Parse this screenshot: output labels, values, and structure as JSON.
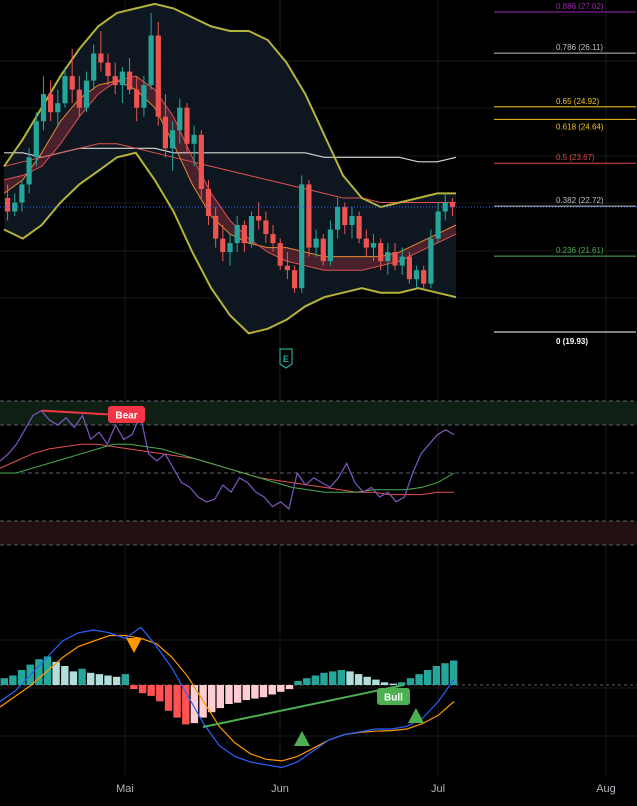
{
  "colors": {
    "background": "#000000",
    "grid": "#1a1a1a",
    "up_candle": "#26a69a",
    "down_candle": "#ef5350",
    "bollinger": "#b5b33a",
    "bollinger_fill": "#0f1a22",
    "ema_fast": "#e68a2e",
    "ema_slow": "#e05252",
    "sma_long": "#d8d8d8",
    "rsi_line": "#7e57c2",
    "rsi_ma_a": "#e05252",
    "rsi_ma_b": "#4caf50",
    "rsi_overbought_zone": "#0f1f14",
    "rsi_oversold_zone": "#220f12",
    "macd_line": "#2962ff",
    "signal_line": "#ff9800",
    "hist_up_strong": "#26a69a",
    "hist_up_weak": "#b2dfdb",
    "hist_down_strong": "#ff5252",
    "hist_down_weak": "#ffcdd2",
    "bear_badge": "#f23645",
    "bull_badge": "#4caf50",
    "current_price_line": "#2962ff"
  },
  "chart_data": [
    {
      "type": "candlestick",
      "panel": "price",
      "x_axis_labels": [
        "Mai",
        "Jun",
        "Jul",
        "Aug"
      ],
      "earnings_marker": "E",
      "fibonacci_levels": [
        {
          "ratio": "0.886",
          "price": "27.02",
          "label": "0.886 (27.02)",
          "color": "#9c27b0"
        },
        {
          "ratio": "0.786",
          "price": "26.11",
          "label": "0.786 (26.11)",
          "color": "#c0c0c0"
        },
        {
          "ratio": "0.65",
          "price": "24.92",
          "label": "0.65 (24.92)",
          "color": "#f0c419"
        },
        {
          "ratio": "0.618",
          "price": "24.64",
          "label": "0.618 (24.64)",
          "color": "#f0c419"
        },
        {
          "ratio": "0.5",
          "price": "23.67",
          "label": "0.5 (23.67)",
          "color": "#e04848"
        },
        {
          "ratio": "0.382",
          "price": "22.72",
          "label": "0.382 (22.72)",
          "color": "#c0c0c0"
        },
        {
          "ratio": "0.236",
          "price": "21.61",
          "label": "0.236 (21.61)",
          "color": "#4caf50"
        },
        {
          "ratio": "0",
          "price": "19.93",
          "label": "0 (19.93)",
          "color": "#ffffff"
        }
      ],
      "price_range": [
        19.93,
        27.02
      ],
      "candles": [
        [
          22.9,
          23.2,
          22.4,
          22.6
        ],
        [
          22.6,
          23.0,
          22.5,
          22.8
        ],
        [
          22.8,
          23.3,
          22.6,
          23.2
        ],
        [
          23.2,
          24.0,
          23.0,
          23.8
        ],
        [
          23.8,
          24.8,
          23.6,
          24.6
        ],
        [
          24.6,
          25.6,
          24.4,
          25.2
        ],
        [
          25.2,
          25.5,
          24.6,
          24.8
        ],
        [
          24.8,
          25.3,
          24.5,
          25.0
        ],
        [
          25.0,
          25.8,
          24.9,
          25.6
        ],
        [
          25.6,
          26.2,
          25.0,
          25.3
        ],
        [
          25.3,
          25.6,
          24.7,
          24.9
        ],
        [
          24.9,
          25.7,
          24.8,
          25.5
        ],
        [
          25.5,
          26.3,
          25.3,
          26.1
        ],
        [
          26.1,
          26.6,
          25.7,
          25.9
        ],
        [
          25.9,
          26.1,
          25.4,
          25.6
        ],
        [
          25.6,
          25.9,
          25.2,
          25.4
        ],
        [
          25.4,
          25.8,
          25.0,
          25.7
        ],
        [
          25.7,
          26.0,
          25.2,
          25.3
        ],
        [
          25.3,
          25.6,
          24.6,
          24.9
        ],
        [
          24.9,
          25.6,
          24.7,
          25.4
        ],
        [
          25.4,
          27.0,
          25.3,
          26.5
        ],
        [
          26.5,
          26.8,
          24.5,
          24.7
        ],
        [
          24.7,
          25.2,
          23.8,
          24.0
        ],
        [
          24.0,
          24.6,
          23.5,
          24.4
        ],
        [
          24.4,
          25.1,
          24.1,
          24.9
        ],
        [
          24.9,
          25.0,
          23.9,
          24.1
        ],
        [
          24.1,
          24.5,
          23.6,
          24.3
        ],
        [
          24.3,
          24.4,
          22.9,
          23.1
        ],
        [
          23.1,
          23.3,
          22.3,
          22.5
        ],
        [
          22.5,
          22.7,
          21.8,
          22.0
        ],
        [
          22.0,
          22.3,
          21.5,
          21.7
        ],
        [
          21.7,
          22.1,
          21.4,
          21.9
        ],
        [
          21.9,
          22.5,
          21.7,
          22.3
        ],
        [
          22.3,
          22.4,
          21.7,
          21.9
        ],
        [
          21.9,
          22.6,
          21.8,
          22.5
        ],
        [
          22.5,
          22.8,
          22.2,
          22.4
        ],
        [
          22.4,
          22.6,
          21.9,
          22.1
        ],
        [
          22.1,
          22.3,
          21.7,
          21.9
        ],
        [
          21.9,
          22.0,
          21.3,
          21.4
        ],
        [
          21.4,
          21.7,
          21.1,
          21.3
        ],
        [
          21.3,
          21.4,
          20.8,
          20.9
        ],
        [
          20.9,
          23.4,
          20.8,
          23.2
        ],
        [
          23.2,
          23.3,
          21.6,
          21.8
        ],
        [
          21.8,
          22.2,
          21.6,
          22.0
        ],
        [
          22.0,
          22.1,
          21.4,
          21.5
        ],
        [
          21.5,
          22.4,
          21.4,
          22.2
        ],
        [
          22.2,
          22.9,
          22.0,
          22.7
        ],
        [
          22.7,
          22.8,
          22.1,
          22.3
        ],
        [
          22.3,
          22.7,
          22.0,
          22.5
        ],
        [
          22.5,
          22.6,
          21.9,
          22.0
        ],
        [
          22.0,
          22.2,
          21.6,
          21.8
        ],
        [
          21.8,
          22.1,
          21.5,
          21.9
        ],
        [
          21.9,
          22.0,
          21.3,
          21.5
        ],
        [
          21.5,
          21.9,
          21.2,
          21.7
        ],
        [
          21.7,
          21.9,
          21.3,
          21.4
        ],
        [
          21.4,
          21.8,
          21.2,
          21.6
        ],
        [
          21.6,
          21.7,
          21.0,
          21.1
        ],
        [
          21.1,
          21.4,
          20.9,
          21.3
        ],
        [
          21.3,
          21.4,
          20.9,
          21.0
        ],
        [
          21.0,
          22.2,
          20.9,
          22.0
        ],
        [
          22.0,
          22.8,
          21.9,
          22.6
        ],
        [
          22.6,
          23.0,
          22.4,
          22.8
        ],
        [
          22.8,
          22.9,
          22.5,
          22.7
        ]
      ],
      "bollinger_upper": [
        23.6,
        24.2,
        24.9,
        25.6,
        26.2,
        26.7,
        27.0,
        27.1,
        27.2,
        27.1,
        26.9,
        26.7,
        26.6,
        26.6,
        26.4,
        25.9,
        25.2,
        24.3,
        23.4,
        22.9,
        22.7,
        22.8,
        22.9,
        23.0,
        23.0
      ],
      "bollinger_lower": [
        22.2,
        22.0,
        22.3,
        22.8,
        23.2,
        23.5,
        23.8,
        23.9,
        23.3,
        22.6,
        21.7,
        20.9,
        20.3,
        19.9,
        20.0,
        20.2,
        20.5,
        20.7,
        20.8,
        20.9,
        20.8,
        20.8,
        20.9,
        20.8,
        20.7
      ],
      "ema_fast": [
        23.0,
        23.3,
        23.9,
        24.6,
        25.1,
        25.4,
        25.5,
        25.3,
        24.9,
        24.1,
        23.2,
        22.5,
        22.1,
        21.9,
        21.8,
        21.8,
        21.7,
        21.6,
        21.6,
        21.6,
        21.6,
        21.7,
        21.9,
        22.1,
        22.3
      ],
      "ema_slow": [
        23.3,
        23.4,
        23.6,
        24.1,
        24.7,
        25.2,
        25.5,
        25.6,
        25.3,
        24.7,
        23.8,
        23.0,
        22.4,
        22.0,
        21.7,
        21.5,
        21.4,
        21.3,
        21.3,
        21.3,
        21.4,
        21.5,
        21.7,
        21.9,
        22.1
      ],
      "sma_long": [
        23.9,
        23.9,
        23.8,
        23.9,
        24.0,
        24.0,
        24.0,
        24.0,
        24.0,
        23.9,
        23.9,
        23.9,
        23.9,
        23.9,
        23.9,
        23.9,
        23.9,
        23.8,
        23.8,
        23.8,
        23.8,
        23.8,
        23.7,
        23.7,
        23.8
      ],
      "sma_mid": [
        23.6,
        23.7,
        23.8,
        23.9,
        24.0,
        24.1,
        24.1,
        24.0,
        23.9,
        23.8,
        23.7,
        23.6,
        23.5,
        23.4,
        23.3,
        23.2,
        23.1,
        23.0,
        22.9,
        22.9,
        22.8,
        22.8,
        22.8,
        22.8,
        22.8
      ]
    },
    {
      "type": "line",
      "panel": "rsi",
      "levels": [
        80,
        70,
        50,
        30,
        20
      ],
      "divergence_label": "Bear",
      "rsi": [
        55,
        58,
        62,
        68,
        74,
        76,
        72,
        70,
        73,
        69,
        74,
        64,
        67,
        62,
        70,
        64,
        66,
        74,
        58,
        55,
        58,
        52,
        46,
        44,
        40,
        38,
        39,
        45,
        42,
        48,
        46,
        42,
        40,
        36,
        38,
        35,
        50,
        45,
        48,
        46,
        44,
        48,
        54,
        46,
        42,
        44,
        40,
        42,
        38,
        40,
        50,
        58,
        62,
        66,
        68,
        66
      ],
      "rsi_ma_slow": [
        52,
        55,
        58,
        60,
        61,
        62,
        62,
        61,
        60,
        59,
        58,
        57,
        56,
        54,
        52,
        50,
        48,
        47,
        46,
        45,
        44,
        43,
        42,
        42,
        41,
        41,
        41,
        42,
        42
      ],
      "rsi_ma_fast": [
        50,
        50,
        52,
        54,
        56,
        58,
        60,
        62,
        62,
        61,
        60,
        58,
        56,
        54,
        52,
        50,
        48,
        46,
        44,
        43,
        42,
        42,
        42,
        43,
        43,
        43,
        44,
        46,
        50
      ]
    },
    {
      "type": "bar",
      "panel": "macd",
      "signal_markers": [
        "sell",
        "buy",
        "buy"
      ],
      "divergence_label": "Bull",
      "histogram": [
        0.1,
        0.14,
        0.22,
        0.3,
        0.38,
        0.42,
        0.34,
        0.28,
        0.2,
        0.24,
        0.18,
        0.16,
        0.14,
        0.12,
        0.16,
        -0.06,
        -0.12,
        -0.16,
        -0.24,
        -0.38,
        -0.48,
        -0.58,
        -0.56,
        -0.48,
        -0.4,
        -0.34,
        -0.28,
        -0.26,
        -0.22,
        -0.2,
        -0.18,
        -0.14,
        -0.1,
        -0.06,
        0.06,
        0.1,
        0.14,
        0.18,
        0.2,
        0.22,
        0.2,
        0.16,
        0.12,
        0.08,
        0.04,
        0.02,
        0.04,
        0.1,
        0.16,
        0.22,
        0.28,
        0.32,
        0.36
      ],
      "macd": [
        -0.3,
        -0.1,
        0.2,
        0.5,
        0.8,
        0.95,
        1.0,
        0.95,
        0.85,
        1.05,
        0.7,
        0.3,
        -0.2,
        -0.7,
        -1.1,
        -1.3,
        -1.4,
        -1.45,
        -1.5,
        -1.4,
        -1.2,
        -1.0,
        -0.9,
        -0.85,
        -0.8,
        -0.8,
        -0.75,
        -0.6,
        -0.3,
        0.1
      ],
      "signal": [
        -0.4,
        -0.2,
        0.0,
        0.25,
        0.5,
        0.7,
        0.8,
        0.9,
        0.9,
        0.85,
        0.75,
        0.5,
        0.15,
        -0.3,
        -0.75,
        -1.05,
        -1.25,
        -1.35,
        -1.38,
        -1.3,
        -1.15,
        -1.0,
        -0.9,
        -0.86,
        -0.84,
        -0.83,
        -0.8,
        -0.7,
        -0.55,
        -0.3
      ]
    }
  ]
}
